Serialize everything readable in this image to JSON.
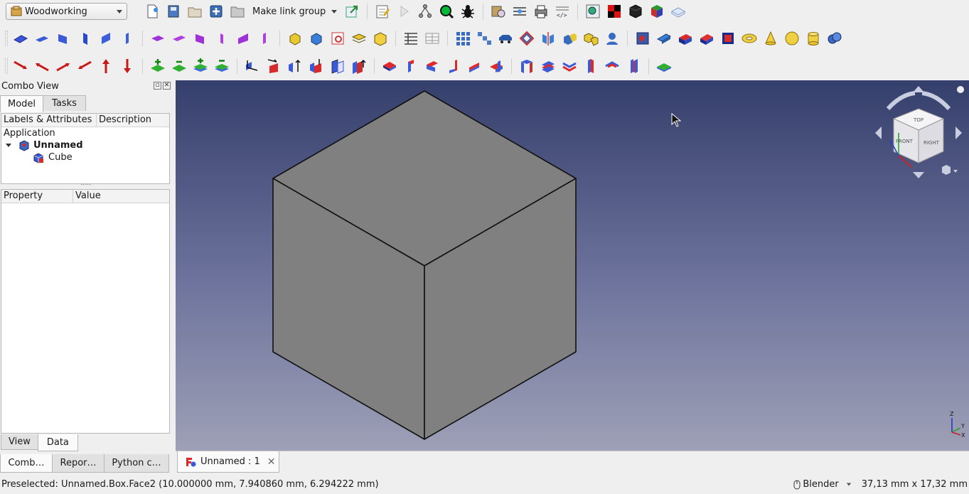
{
  "toolbar": {
    "workbench": "Woodworking",
    "link_group_label": "Make link group"
  },
  "combo_view": {
    "title": "Combo View",
    "tabs": [
      "Model",
      "Tasks"
    ],
    "tree_headers": [
      "Labels & Attributes",
      "Description"
    ],
    "tree": {
      "root": "Application",
      "document": "Unnamed",
      "object": "Cube"
    },
    "property_headers": [
      "Property",
      "Value"
    ],
    "property_tabs": [
      "View",
      "Data"
    ]
  },
  "bottom_tabs": [
    "Comb…",
    "Repor…",
    "Python c…"
  ],
  "document_tab": {
    "label": "Unnamed : 1",
    "close": "✕"
  },
  "statusbar": {
    "message": "Preselected: Unnamed.Box.Face2 (10.000000 mm, 7.940860 mm, 6.294222 mm)",
    "navigation_style": "Blender",
    "dimensions": "37,13 mm x 17,32 mm"
  },
  "navcube": {
    "faces": [
      "TOP",
      "FRONT",
      "RIGHT"
    ]
  },
  "axes": [
    "Z",
    "Y",
    "X"
  ]
}
